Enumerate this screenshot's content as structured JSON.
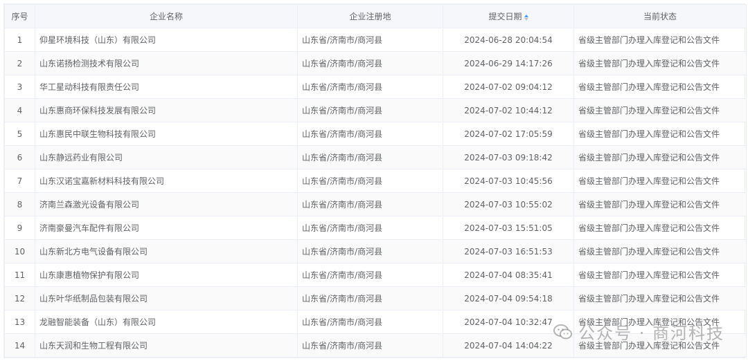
{
  "headers": {
    "idx": "序号",
    "name": "企业名称",
    "place": "企业注册地",
    "date": "提交日期",
    "status": "当前状态"
  },
  "rows": [
    {
      "idx": "1",
      "name": "仰星环境科技（山东）有限公司",
      "place": "山东省/济南市/商河县",
      "date": "2024-06-28 20:04:54",
      "status": "省级主管部门办理入库登记和公告文件"
    },
    {
      "idx": "2",
      "name": "山东诺扬检测技术有限公司",
      "place": "山东省/济南市/商河县",
      "date": "2024-06-29 14:17:26",
      "status": "省级主管部门办理入库登记和公告文件"
    },
    {
      "idx": "3",
      "name": "华工星动科技有限责任公司",
      "place": "山东省/济南市/商河县",
      "date": "2024-07-02 09:04:12",
      "status": "省级主管部门办理入库登记和公告文件"
    },
    {
      "idx": "4",
      "name": "山东惠商环保科技发展有限公司",
      "place": "山东省/济南市/商河县",
      "date": "2024-07-02 10:44:12",
      "status": "省级主管部门办理入库登记和公告文件"
    },
    {
      "idx": "5",
      "name": "山东惠民中联生物科技有限公司",
      "place": "山东省/济南市/商河县",
      "date": "2024-07-02 17:05:59",
      "status": "省级主管部门办理入库登记和公告文件"
    },
    {
      "idx": "6",
      "name": "山东静远药业有限公司",
      "place": "山东省/济南市/商河县",
      "date": "2024-07-03 09:18:42",
      "status": "省级主管部门办理入库登记和公告文件"
    },
    {
      "idx": "7",
      "name": "山东汉诺宝嘉新材料科技有限公司",
      "place": "山东省/济南市/商河县",
      "date": "2024-07-03 10:45:56",
      "status": "省级主管部门办理入库登记和公告文件"
    },
    {
      "idx": "8",
      "name": "济南兰森激光设备有限公司",
      "place": "山东省/济南市/商河县",
      "date": "2024-07-03 10:55:02",
      "status": "省级主管部门办理入库登记和公告文件"
    },
    {
      "idx": "9",
      "name": "济南豪曼汽车配件有限公司",
      "place": "山东省/济南市/商河县",
      "date": "2024-07-03 15:51:05",
      "status": "省级主管部门办理入库登记和公告文件"
    },
    {
      "idx": "10",
      "name": "山东新北方电气设备有限公司",
      "place": "山东省/济南市/商河县",
      "date": "2024-07-03 16:51:53",
      "status": "省级主管部门办理入库登记和公告文件"
    },
    {
      "idx": "11",
      "name": "山东康惠植物保护有限公司",
      "place": "山东省/济南市/商河县",
      "date": "2024-07-04 08:35:41",
      "status": "省级主管部门办理入库登记和公告文件"
    },
    {
      "idx": "12",
      "name": "山东叶华纸制品包装有限公司",
      "place": "山东省/济南市/商河县",
      "date": "2024-07-04 09:54:18",
      "status": "省级主管部门办理入库登记和公告文件"
    },
    {
      "idx": "13",
      "name": "龙融智能装备（山东）有限公司",
      "place": "山东省/济南市/商河县",
      "date": "2024-07-04 10:32:47",
      "status": "省级主管部门办理入库登记和公告文件"
    },
    {
      "idx": "14",
      "name": "山东天润和生物工程有限公司",
      "place": "山东省/济南市/商河县",
      "date": "2024-07-04 14:04:22",
      "status": "省级主管部门办理入库登记和公告文件"
    }
  ],
  "watermark": {
    "text": "公众号 · 商河科技",
    "icon": "wechat-icon"
  },
  "colors": {
    "header_bg": "#f5f7fa",
    "border": "#ebeef5",
    "sort_active": "#409eff"
  }
}
